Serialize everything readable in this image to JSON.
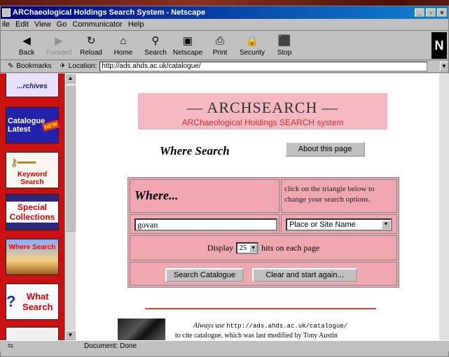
{
  "window": {
    "title": "ARChaeological Holdings Search System - Netscape"
  },
  "menu": [
    "ile",
    "Edit",
    "View",
    "Go",
    "Communicator",
    "Help"
  ],
  "toolbar": [
    {
      "label": "Back",
      "icon": "back-arrow-icon",
      "glyph": "◀"
    },
    {
      "label": "Forward",
      "icon": "forward-arrow-icon",
      "glyph": "▶"
    },
    {
      "label": "Reload",
      "icon": "reload-icon",
      "glyph": "↻"
    },
    {
      "label": "Home",
      "icon": "home-icon",
      "glyph": "⌂"
    },
    {
      "label": "Search",
      "icon": "search-icon",
      "glyph": "⚲"
    },
    {
      "label": "Netscape",
      "icon": "netscape-icon",
      "glyph": "▣"
    },
    {
      "label": "Print",
      "icon": "print-icon",
      "glyph": "⎙"
    },
    {
      "label": "Security",
      "icon": "security-icon",
      "glyph": "🔒"
    },
    {
      "label": "Stop",
      "icon": "stop-icon",
      "glyph": "⬛"
    }
  ],
  "location": {
    "bookmarks_label": "Bookmarks",
    "location_label": "Location:",
    "url": "http://ads.ahds.ac.uk/catalogue/"
  },
  "sidebar": {
    "archives": "...rchives",
    "catalogue_latest": "Catalogue Latest",
    "new_badge": "NEW",
    "keyword_search": "Keyword Search",
    "special_collections": "Special Collections",
    "where_search": "Where Search",
    "what_search": "What Search"
  },
  "banner": {
    "title": "— ARCHSEARCH —",
    "subtitle": "ARChaeological Holdings SEARCH system"
  },
  "heading": "Where Search",
  "about_button": "About this page",
  "form": {
    "where_label": "Where...",
    "hint": "click on the triangle below to change your search options.",
    "query_value": "govan",
    "search_type": "Place or Site Name",
    "display_prefix": "Display",
    "hits_value": "25",
    "display_suffix": "hits on each page",
    "search_button": "Search Catalogue",
    "clear_button": "Clear and start again..."
  },
  "footer": {
    "line1_prefix": "Always use",
    "line1_url": "http://ads.ahds.ac.uk/catalogue/",
    "line2": "to cite catalogue, which was last modified by Tony Austin"
  },
  "status": {
    "text": "Document: Done"
  }
}
